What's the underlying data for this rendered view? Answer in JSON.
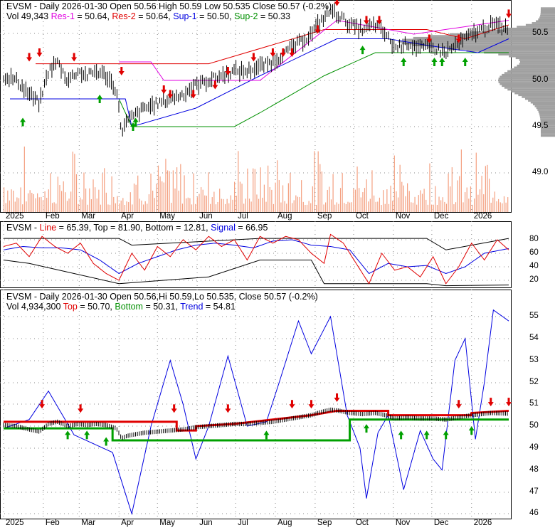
{
  "panels": {
    "price": {
      "line1": {
        "prefix": "EVSM - Daily 2026-01-30 Open 50.56  High 50.59  Low 50.535  Close 50.57 (-0.2%)"
      },
      "line2": {
        "vol": "Vol 49,343",
        "res1": "Res-1",
        "res1_val": " = 50.64, ",
        "res2": "Res-2",
        "res2_val": " = 50.64, ",
        "sup1": "Sup-1",
        "sup1_val": " = 50.50, ",
        "sup2": "Sup-2",
        "sup2_val": " = 50.33"
      }
    },
    "osc": {
      "prefix": "EVSM - ",
      "line": "Line",
      "line_val": " = 65.39, Top = 81.90, Bottom = 12.81, ",
      "signal": "Signal",
      "signal_val": " = 66.95"
    },
    "trend": {
      "line1": "EVSM - Daily 2026-01-30 Open 50.56,Hi 50.59,Lo 50.535, Close 50.57 (-0.2%)",
      "vol": "Vol 4,934,300 ",
      "top": "Top",
      "top_val": " = 50.70, ",
      "bottom": "Bottom",
      "bottom_val": " = 50.31, ",
      "trend": "Trend",
      "trend_val": " = 54.81"
    }
  },
  "colors": {
    "volume": "#f4a080",
    "res1": "#e000e0",
    "res2": "#e00000",
    "sup1": "#0000e0",
    "sup2": "#009000",
    "profile": "#a0a0a0"
  },
  "chart_data": [
    {
      "type": "ohlc",
      "title": "EVSM - Daily",
      "x_unit": "days since 2025-01-01",
      "ylim": [
        48.8,
        50.8
      ],
      "yticks": [
        "50.5",
        "50.0",
        "49.5",
        "49.0"
      ],
      "close": [
        [
          0,
          50.05
        ],
        [
          10,
          50.0
        ],
        [
          20,
          49.85
        ],
        [
          28,
          49.75
        ],
        [
          35,
          50.1
        ],
        [
          42,
          50.2
        ],
        [
          50,
          50.0
        ],
        [
          58,
          50.1
        ],
        [
          65,
          50.05
        ],
        [
          72,
          50.1
        ],
        [
          80,
          50.05
        ],
        [
          88,
          49.9
        ],
        [
          92,
          49.45
        ],
        [
          96,
          49.55
        ],
        [
          100,
          49.6
        ],
        [
          110,
          49.7
        ],
        [
          120,
          49.75
        ],
        [
          130,
          49.8
        ],
        [
          140,
          49.85
        ],
        [
          150,
          49.95
        ],
        [
          160,
          50.0
        ],
        [
          170,
          50.05
        ],
        [
          180,
          50.1
        ],
        [
          190,
          50.1
        ],
        [
          200,
          50.15
        ],
        [
          210,
          50.2
        ],
        [
          220,
          50.3
        ],
        [
          230,
          50.4
        ],
        [
          240,
          50.5
        ],
        [
          248,
          50.65
        ],
        [
          255,
          50.75
        ],
        [
          262,
          50.7
        ],
        [
          270,
          50.6
        ],
        [
          280,
          50.55
        ],
        [
          290,
          50.6
        ],
        [
          298,
          50.5
        ],
        [
          305,
          50.35
        ],
        [
          315,
          50.4
        ],
        [
          325,
          50.35
        ],
        [
          335,
          50.35
        ],
        [
          345,
          50.3
        ],
        [
          355,
          50.4
        ],
        [
          365,
          50.5
        ],
        [
          380,
          50.6
        ],
        [
          394,
          50.57
        ]
      ],
      "res1": [
        [
          90,
          50.2
        ],
        [
          115,
          50.2
        ],
        [
          125,
          50.0
        ],
        [
          200,
          50.0
        ],
        [
          260,
          50.65
        ],
        [
          320,
          50.5
        ],
        [
          394,
          50.65
        ]
      ],
      "res2": [
        [
          25,
          50.18
        ],
        [
          160,
          50.18
        ],
        [
          250,
          50.55
        ],
        [
          330,
          50.55
        ],
        [
          360,
          50.45
        ],
        [
          394,
          50.6
        ]
      ],
      "sup1": [
        [
          5,
          49.8
        ],
        [
          95,
          49.8
        ],
        [
          100,
          49.5
        ],
        [
          150,
          49.7
        ],
        [
          200,
          50.05
        ],
        [
          260,
          50.45
        ],
        [
          300,
          50.45
        ],
        [
          330,
          50.38
        ],
        [
          370,
          50.3
        ],
        [
          394,
          50.45
        ]
      ],
      "sup2": [
        [
          5,
          49.8
        ],
        [
          90,
          49.8
        ],
        [
          100,
          49.5
        ],
        [
          180,
          49.5
        ],
        [
          200,
          49.65
        ],
        [
          250,
          50.05
        ],
        [
          290,
          50.3
        ],
        [
          394,
          50.3
        ]
      ],
      "down_arrows": [
        [
          20,
          50.25
        ],
        [
          28,
          50.3
        ],
        [
          55,
          50.25
        ],
        [
          92,
          50.1
        ],
        [
          125,
          49.9
        ],
        [
          130,
          49.85
        ],
        [
          148,
          49.85
        ],
        [
          165,
          49.95
        ],
        [
          175,
          50.1
        ],
        [
          195,
          50.25
        ],
        [
          210,
          50.3
        ],
        [
          218,
          50.3
        ],
        [
          225,
          50.3
        ],
        [
          245,
          50.55
        ],
        [
          260,
          50.85
        ],
        [
          283,
          50.65
        ],
        [
          293,
          50.65
        ],
        [
          332,
          50.45
        ],
        [
          355,
          50.45
        ],
        [
          394,
          50.72
        ]
      ],
      "up_arrows": [
        [
          15,
          49.55
        ],
        [
          75,
          49.8
        ],
        [
          101,
          49.5
        ],
        [
          103,
          49.55
        ],
        [
          280,
          50.33
        ],
        [
          312,
          50.2
        ],
        [
          336,
          50.2
        ],
        [
          342,
          50.2
        ],
        [
          360,
          50.2
        ]
      ]
    },
    {
      "type": "line",
      "ylim": [
        5,
        95
      ],
      "yticks": [
        "80",
        "60",
        "40",
        "20"
      ],
      "line": [
        [
          0,
          70
        ],
        [
          10,
          75
        ],
        [
          20,
          55
        ],
        [
          30,
          85
        ],
        [
          40,
          70
        ],
        [
          50,
          60
        ],
        [
          60,
          75
        ],
        [
          70,
          45
        ],
        [
          80,
          30
        ],
        [
          90,
          20
        ],
        [
          100,
          60
        ],
        [
          110,
          35
        ],
        [
          120,
          70
        ],
        [
          130,
          55
        ],
        [
          140,
          80
        ],
        [
          150,
          65
        ],
        [
          160,
          85
        ],
        [
          170,
          70
        ],
        [
          180,
          80
        ],
        [
          190,
          50
        ],
        [
          200,
          85
        ],
        [
          210,
          75
        ],
        [
          220,
          85
        ],
        [
          230,
          80
        ],
        [
          240,
          60
        ],
        [
          250,
          45
        ],
        [
          255,
          88
        ],
        [
          265,
          75
        ],
        [
          275,
          45
        ],
        [
          285,
          15
        ],
        [
          295,
          60
        ],
        [
          305,
          35
        ],
        [
          315,
          40
        ],
        [
          325,
          25
        ],
        [
          335,
          55
        ],
        [
          345,
          15
        ],
        [
          355,
          40
        ],
        [
          365,
          75
        ],
        [
          375,
          50
        ],
        [
          385,
          80
        ],
        [
          394,
          65
        ]
      ],
      "signal": [
        [
          0,
          65
        ],
        [
          15,
          70
        ],
        [
          30,
          68
        ],
        [
          45,
          68
        ],
        [
          60,
          65
        ],
        [
          75,
          50
        ],
        [
          90,
          30
        ],
        [
          105,
          45
        ],
        [
          120,
          55
        ],
        [
          135,
          65
        ],
        [
          150,
          72
        ],
        [
          165,
          75
        ],
        [
          180,
          72
        ],
        [
          195,
          68
        ],
        [
          210,
          78
        ],
        [
          225,
          80
        ],
        [
          240,
          72
        ],
        [
          255,
          70
        ],
        [
          270,
          65
        ],
        [
          285,
          30
        ],
        [
          300,
          45
        ],
        [
          315,
          40
        ],
        [
          330,
          42
        ],
        [
          345,
          30
        ],
        [
          360,
          40
        ],
        [
          375,
          60
        ],
        [
          394,
          67
        ]
      ],
      "top": [
        [
          0,
          82
        ],
        [
          90,
          82
        ],
        [
          100,
          72
        ],
        [
          200,
          82
        ],
        [
          330,
          82
        ],
        [
          345,
          65
        ],
        [
          394,
          82
        ]
      ],
      "bottom": [
        [
          0,
          50
        ],
        [
          20,
          45
        ],
        [
          90,
          15
        ],
        [
          160,
          25
        ],
        [
          200,
          50
        ],
        [
          240,
          50
        ],
        [
          250,
          15
        ],
        [
          330,
          15
        ],
        [
          345,
          12
        ],
        [
          394,
          13
        ]
      ]
    },
    {
      "type": "line",
      "ylim": [
        45.7,
        55.8
      ],
      "yticks": [
        "55",
        "54",
        "53",
        "52",
        "51",
        "50",
        "49",
        "48",
        "47",
        "46"
      ],
      "trend": [
        [
          0,
          49.9
        ],
        [
          20,
          50.3
        ],
        [
          35,
          51.6
        ],
        [
          55,
          49.6
        ],
        [
          70,
          49.2
        ],
        [
          85,
          48.8
        ],
        [
          100,
          46.0
        ],
        [
          115,
          50.0
        ],
        [
          130,
          53.0
        ],
        [
          140,
          51.0
        ],
        [
          150,
          48.5
        ],
        [
          160,
          50.0
        ],
        [
          175,
          53.2
        ],
        [
          190,
          50.0
        ],
        [
          205,
          50.2
        ],
        [
          215,
          52.0
        ],
        [
          230,
          54.8
        ],
        [
          240,
          53.3
        ],
        [
          255,
          55.0
        ],
        [
          268,
          50.5
        ],
        [
          278,
          49.0
        ],
        [
          283,
          46.7
        ],
        [
          292,
          49.7
        ],
        [
          300,
          50.5
        ],
        [
          312,
          47.1
        ],
        [
          325,
          49.8
        ],
        [
          335,
          48.5
        ],
        [
          342,
          48.0
        ],
        [
          352,
          53.0
        ],
        [
          360,
          54.0
        ],
        [
          368,
          49.4
        ],
        [
          375,
          52.0
        ],
        [
          382,
          55.3
        ],
        [
          394,
          54.8
        ]
      ],
      "top": [
        [
          0,
          50.2
        ],
        [
          135,
          50.2
        ],
        [
          135,
          49.8
        ],
        [
          150,
          49.8
        ],
        [
          150,
          50.0
        ],
        [
          180,
          50.1
        ],
        [
          240,
          50.5
        ],
        [
          260,
          50.7
        ],
        [
          300,
          50.7
        ],
        [
          300,
          50.5
        ],
        [
          365,
          50.5
        ],
        [
          365,
          50.6
        ],
        [
          394,
          50.7
        ]
      ],
      "bottom": [
        [
          0,
          49.9
        ],
        [
          85,
          49.9
        ],
        [
          85,
          49.35
        ],
        [
          270,
          49.35
        ],
        [
          270,
          50.3
        ],
        [
          394,
          50.3
        ]
      ]
    }
  ],
  "x_axis": {
    "labels": [
      "2025",
      "Feb",
      "Mar",
      "Apr",
      "May",
      "Jun",
      "Jul",
      "Aug",
      "Sep",
      "Oct",
      "Nov",
      "Dec",
      "2026"
    ],
    "days": [
      0,
      31,
      59,
      90,
      120,
      151,
      181,
      212,
      243,
      273,
      304,
      334,
      365
    ]
  }
}
